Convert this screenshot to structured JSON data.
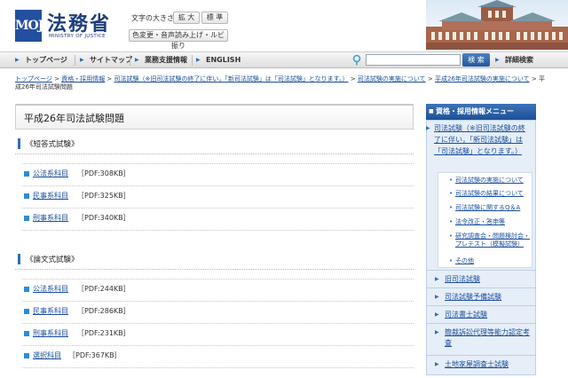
{
  "header": {
    "logo_mark": "MOJ",
    "logo_text": "法務省",
    "logo_sub": "MINISTRY OF JUSTICE",
    "font_size_label": "文字の大きさ",
    "enlarge_label": "拡 大",
    "standard_label": "標 準",
    "accessibility_label": "色変更・音声読み上げ・ルビ振り"
  },
  "nav": {
    "items": [
      "トップページ",
      "サイトマップ",
      "業務支援情報",
      "ENGLISH"
    ],
    "search_button": "検 索",
    "advanced_search": "詳細検索"
  },
  "breadcrumb": {
    "links": [
      "トップページ",
      "資格・採用情報",
      "司法試験（※旧司法試験の終了に伴い，「新司法試験」は「司法試験」となります。）",
      "司法試験の実施について",
      "平成26年司法試験の実施について"
    ],
    "current": "平成26年司法試験問題"
  },
  "main": {
    "title": "平成26年司法試験問題",
    "sections": [
      {
        "heading": "《短答式試験》",
        "files": [
          {
            "name": "公法系科目",
            "size": "［PDF:308KB］"
          },
          {
            "name": "民事系科目",
            "size": "［PDF:325KB］"
          },
          {
            "name": "刑事系科目",
            "size": "［PDF:340KB］"
          }
        ]
      },
      {
        "heading": "《論文式試験》",
        "files": [
          {
            "name": "公法系科目",
            "size": "［PDF:244KB］"
          },
          {
            "name": "民事系科目",
            "size": "［PDF:286KB］"
          },
          {
            "name": "刑事系科目",
            "size": "［PDF:231KB］"
          },
          {
            "name": "選択科目",
            "size": "［PDF:367KB］"
          }
        ]
      }
    ]
  },
  "sidebar": {
    "heading": "資格・採用情報メニュー",
    "current_item": "司法試験（※旧司法試験の終了に伴い，「新司法試験」は「司法試験」となります。）",
    "sub_items": [
      "司法試験の実施について",
      "司法試験の結果について",
      "司法試験に関するQ＆A",
      "法令改正・答申等",
      "研究調査会・問題検討会・プレテスト（模擬試験）",
      "その他"
    ],
    "items": [
      "旧司法試験",
      "司法試験予備試験",
      "司法書士試験",
      "簡裁訴訟代理等能力認定考査",
      "土地家屋調査士試験"
    ]
  },
  "colors": {
    "brand_blue": "#244f9e",
    "link_blue": "#1a4f9c",
    "menu_bg": "#e6eef8"
  }
}
